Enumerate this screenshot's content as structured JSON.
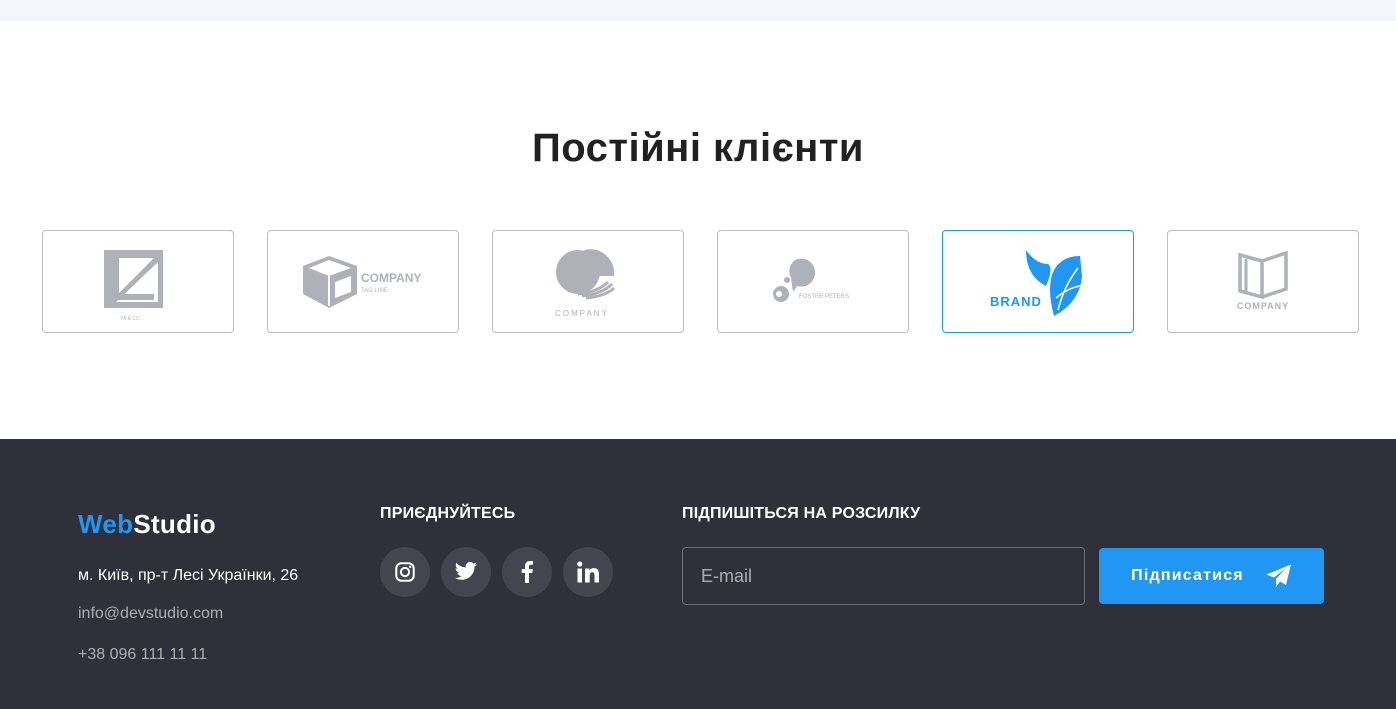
{
  "clients": {
    "title": "Постійні клієнти",
    "logos": [
      {
        "icon": "ya-co-logo-icon",
        "caption": "YA & CO"
      },
      {
        "icon": "company-box-logo-icon",
        "caption": "COMPANY",
        "tagline": "TAG LINE"
      },
      {
        "icon": "company-shell-logo-icon",
        "caption": "COMPANY"
      },
      {
        "icon": "foster-peters-logo-icon",
        "caption": "FOSTER PETERS"
      },
      {
        "icon": "brand-leaf-logo-icon",
        "caption": "BRAND"
      },
      {
        "icon": "company-book-logo-icon",
        "caption": "COMPANY"
      }
    ],
    "active_index": 4,
    "colors": {
      "logo_gray": "#afb1b8",
      "accent": "#2196f3",
      "card_border": "#bdbdbd"
    }
  },
  "footer": {
    "brand_part1": "Web",
    "brand_part2": "Studio",
    "address": "м. Київ, пр-т Лесі Українки, 26",
    "email": "info@devstudio.com",
    "phone": "+38 096 111 11 11",
    "join_title": "ПРИЄДНУЙТЕСЬ",
    "social": [
      "instagram-icon",
      "twitter-icon",
      "facebook-icon",
      "linkedin-icon"
    ],
    "subscribe_title": "ПІДПИШІТЬСЯ НА РОЗСИЛКУ",
    "email_placeholder": "E-mail",
    "subscribe_button": "Підписатися",
    "colors": {
      "background": "#2f303a",
      "accent": "#2196f3"
    }
  }
}
